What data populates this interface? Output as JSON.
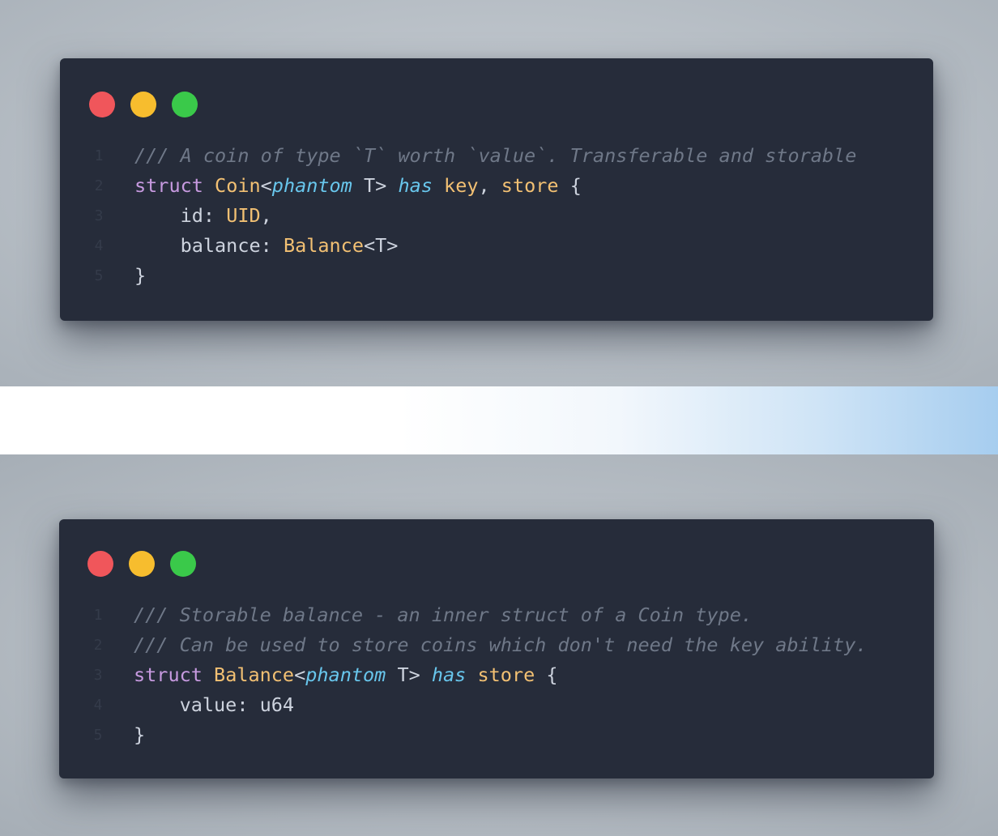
{
  "colors": {
    "window_background": "#262c3a",
    "traffic_red": "#f0565b",
    "traffic_yellow": "#f7bd2e",
    "traffic_green": "#3ac94a",
    "comment": "#6f7888",
    "keyword": "#c79ae0",
    "type": "#f2c073",
    "italic_keyword": "#68c6ec",
    "plain": "#cdd3de"
  },
  "windows": [
    {
      "lines": [
        {
          "number": "1",
          "tokens": [
            {
              "text": "/// A coin of type `T` worth `value`. Transferable and storable",
              "cls": "cmt"
            }
          ]
        },
        {
          "number": "2",
          "tokens": [
            {
              "text": "struct ",
              "cls": "kw"
            },
            {
              "text": "Coin",
              "cls": "ty"
            },
            {
              "text": "<",
              "cls": "pl"
            },
            {
              "text": "phantom",
              "cls": "it"
            },
            {
              "text": " T> ",
              "cls": "pl"
            },
            {
              "text": "has",
              "cls": "it"
            },
            {
              "text": " ",
              "cls": "pl"
            },
            {
              "text": "key",
              "cls": "ty"
            },
            {
              "text": ", ",
              "cls": "pl"
            },
            {
              "text": "store",
              "cls": "ty"
            },
            {
              "text": " {",
              "cls": "pl"
            }
          ]
        },
        {
          "number": "3",
          "tokens": [
            {
              "text": "    id: ",
              "cls": "pl"
            },
            {
              "text": "UID",
              "cls": "ty"
            },
            {
              "text": ",",
              "cls": "pl"
            }
          ]
        },
        {
          "number": "4",
          "tokens": [
            {
              "text": "    balance: ",
              "cls": "pl"
            },
            {
              "text": "Balance",
              "cls": "ty"
            },
            {
              "text": "<T>",
              "cls": "pl"
            }
          ]
        },
        {
          "number": "5",
          "tokens": [
            {
              "text": "}",
              "cls": "pl"
            }
          ]
        }
      ]
    },
    {
      "lines": [
        {
          "number": "1",
          "tokens": [
            {
              "text": "/// Storable balance - an inner struct of a Coin type.",
              "cls": "cmt"
            }
          ]
        },
        {
          "number": "2",
          "tokens": [
            {
              "text": "/// Can be used to store coins which don't need the key ability.",
              "cls": "cmt"
            }
          ]
        },
        {
          "number": "3",
          "tokens": [
            {
              "text": "struct ",
              "cls": "kw"
            },
            {
              "text": "Balance",
              "cls": "ty"
            },
            {
              "text": "<",
              "cls": "pl"
            },
            {
              "text": "phantom",
              "cls": "it"
            },
            {
              "text": " T> ",
              "cls": "pl"
            },
            {
              "text": "has",
              "cls": "it"
            },
            {
              "text": " ",
              "cls": "pl"
            },
            {
              "text": "store",
              "cls": "ty"
            },
            {
              "text": " {",
              "cls": "pl"
            }
          ]
        },
        {
          "number": "4",
          "tokens": [
            {
              "text": "    value: u64",
              "cls": "pl"
            }
          ]
        },
        {
          "number": "5",
          "tokens": [
            {
              "text": "}",
              "cls": "pl"
            }
          ]
        }
      ]
    }
  ]
}
